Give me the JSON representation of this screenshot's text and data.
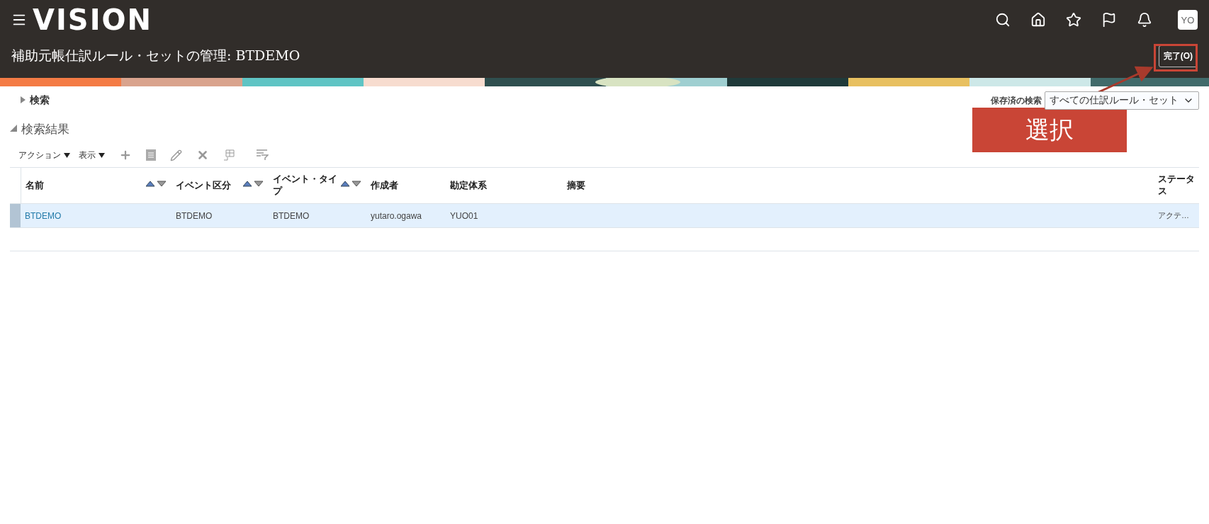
{
  "header": {
    "logo": "VISION",
    "avatar": "YO",
    "page_title": "補助元帳仕訳ルール・セットの管理: BTDEMO",
    "done_button": "完了(O)"
  },
  "search": {
    "label": "検索",
    "expanded": false,
    "saved_search_label": "保存済の検索",
    "saved_search_value": "すべての仕訳ルール・セット"
  },
  "results": {
    "title": "検索結果",
    "expanded": true,
    "menus": [
      "アクション",
      "表示"
    ]
  },
  "table": {
    "columns": [
      {
        "label": "名前",
        "sortable": true
      },
      {
        "label": "イベント区分",
        "sortable": true
      },
      {
        "label": "イベント・タイプ",
        "sortable": true
      },
      {
        "label": "作成者",
        "sortable": false
      },
      {
        "label": "勘定体系",
        "sortable": false
      },
      {
        "label": "摘要",
        "sortable": false
      },
      {
        "label": "ステータス",
        "sortable": false
      }
    ],
    "rows": [
      {
        "selected": true,
        "cells": [
          "BTDEMO",
          "BTDEMO",
          "BTDEMO",
          "yutaro.ogawa",
          "YUO01",
          "",
          "アクテ…"
        ]
      }
    ]
  },
  "annotation": {
    "label": "選択"
  }
}
